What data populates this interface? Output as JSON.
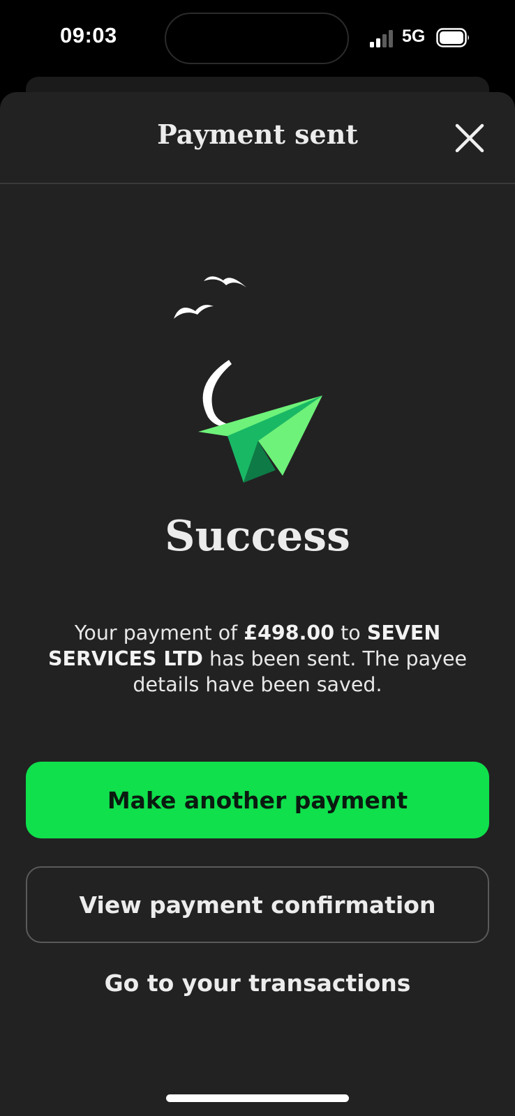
{
  "status_bar": {
    "time": "09:03",
    "network": "5G",
    "icons": [
      "signal-icon",
      "battery-icon"
    ]
  },
  "header": {
    "title": "Payment sent",
    "close_icon": "close-icon"
  },
  "illustration": {
    "icon": "paper-plane-icon",
    "colors": {
      "plane_light": "#6ef27a",
      "plane_mid": "#19b865",
      "plane_dark": "#0e7a45",
      "birds": "#ffffff"
    }
  },
  "content": {
    "heading": "Success",
    "message_prefix": "Your payment of ",
    "amount": "£498.00",
    "message_middle": " to ",
    "payee": "SEVEN SERVICES LTD",
    "message_suffix": " has been sent. The payee details have been saved."
  },
  "actions": {
    "primary": "Make another payment",
    "secondary": "View payment confirmation",
    "link": "Go to your transactions"
  },
  "colors": {
    "accent": "#0fe04c",
    "sheet_background": "#222222",
    "background": "#000000"
  }
}
